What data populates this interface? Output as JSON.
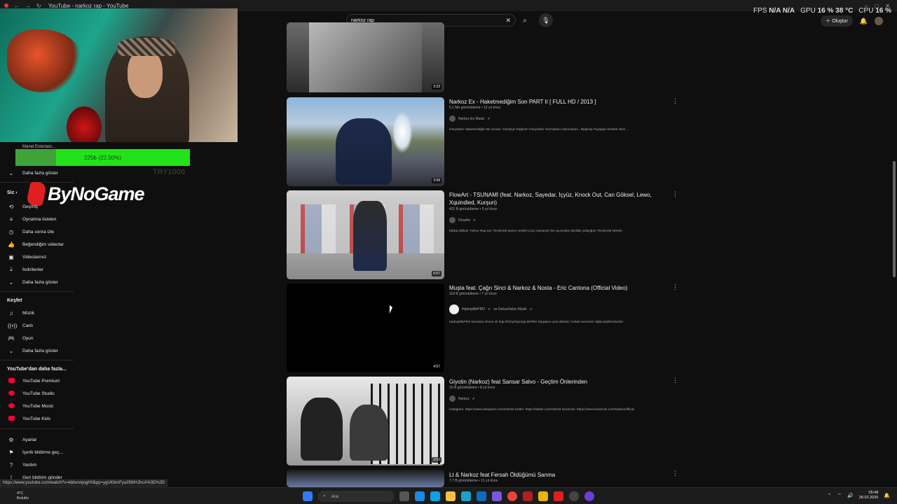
{
  "window": {
    "title": "YouTube - narkoz rap - YouTube"
  },
  "search": {
    "value": "narkoz rap",
    "placeholder": "Ara"
  },
  "perf": {
    "fps_label": "FPS",
    "fps_value": "N/A",
    "fps_value2": "N/A",
    "gpu_label": "GPU",
    "gpu_value": "16 %",
    "gpu_temp": "38 °C",
    "cpu_label": "CPU",
    "cpu_value": "16 %"
  },
  "header": {
    "create_label": "Oluştur"
  },
  "donation": {
    "name": "Manel Entertain...",
    "progress_text": "225₺ (22.50%)",
    "progress": 0.225,
    "goal": "TRY1000"
  },
  "brand": {
    "logo_text": "ByNoGame"
  },
  "sidebar": {
    "show_more_top": "Daha fazla göster",
    "you_label": "Siz",
    "you_items": [
      {
        "icon": "history-icon",
        "label": "Geçmiş"
      },
      {
        "icon": "playlist-icon",
        "label": "Oynatma listeleri"
      },
      {
        "icon": "watch-later-icon",
        "label": "Daha sonra izle"
      },
      {
        "icon": "like-icon",
        "label": "Beğendiğim videolar"
      },
      {
        "icon": "video-icon",
        "label": "Videolarınız"
      },
      {
        "icon": "download-icon",
        "label": "İndirilenler"
      },
      {
        "icon": "chevron-down-icon",
        "label": "Daha fazla göster"
      }
    ],
    "explore_label": "Keşfet",
    "explore_items": [
      {
        "icon": "music-icon",
        "label": "Müzik"
      },
      {
        "icon": "live-icon",
        "label": "Canlı"
      },
      {
        "icon": "gaming-icon",
        "label": "Oyun"
      },
      {
        "icon": "chevron-down-icon",
        "label": "Daha fazla göster"
      }
    ],
    "more_label": "YouTube'dan daha fazla...",
    "more_items": [
      {
        "label": "YouTube Premium"
      },
      {
        "label": "YouTube Studio"
      },
      {
        "label": "YouTube Music"
      },
      {
        "label": "YouTube Kids"
      }
    ],
    "settings_items": [
      {
        "icon": "gear-icon",
        "label": "Ayarlar"
      },
      {
        "icon": "flag-icon",
        "label": "İçerik bildirme geç..."
      },
      {
        "icon": "help-icon",
        "label": "Yardım"
      },
      {
        "icon": "feedback-icon",
        "label": "Geri bildirim gönder"
      }
    ]
  },
  "videos": [
    {
      "duration": "3:33"
    },
    {
      "title": "Narkoz Ex - Haketmediğim Son PART II [ FULL HD / 2013 ]",
      "meta": "5,1 Mn görüntüleme • 12 yıl önce",
      "channel": "Narkoz Ex Music",
      "desc": "Gerçekten Haketmediğim Bir Sondu ! Herşeye Rağmen Gerçekleri Yazmaktan Utanmadım.. Beğenip Paylaşan Destek Olan ...",
      "duration": "3:58"
    },
    {
      "title": "FlowArt - TSUNAMİ (feat. Narkoz, Sayedar, İçyüz, Knock Out, Can Göksel, Lewo, Xquindied, Kurşun)",
      "meta": "422 B görüntüleme • 5 yıl önce",
      "channel": "FlowArt",
      "desc": "Dikkat dikkat! Türkçe Rap için TSUNAMİ alarmı verildi! Uzun zamandır her açısından titizlikle çalıştığım TSUNAMİ sizlerle.",
      "duration": "6:57"
    },
    {
      "title": "Muşta feat. Çağrı Sinci & Narkoz & Nosta - Eric Cantona (Official Video)",
      "meta": "118 B görüntüleme • 7 yıl önce",
      "channel": "HiphoplifePRO",
      "channel2": "ve DokuzSekiz Müzik",
      "desc": "HiphoplifePRO kanalına Abone ol! http://bit.ly/HipHopLifePRO Muştanın yeni albümü 'Sokak Serserisi' dijital platformlarda!",
      "duration": "4:57"
    },
    {
      "title": "Giyotin (Narkoz) feat Sansar Salvo - Geçtim Önlerinden",
      "meta": "10 B görüntüleme • 8 yıl önce",
      "channel": "Narkoz",
      "desc": "instagram: https://www.instagram.com/nrkz34 twitter: https://twitter.com/nrkz34 facebook: https://www.facebook.com/Narkozofficial",
      "duration": "2:52"
    },
    {
      "title": "Lt & Narkoz feat Fersah Öldüğümü Sanma",
      "meta": "7,7 B görüntüleme • 11 yıl önce"
    }
  ],
  "statusbar": {
    "url": "https://www.youtube.com/watch?v=kbbxnnjogH0&pp=ygUKbmFya296IHJhcA%3D%3D"
  },
  "taskbar": {
    "temp": "4°C",
    "weather": "Bulutlu",
    "search": "Ara",
    "time": "05:48",
    "date": "28.02.2026"
  }
}
